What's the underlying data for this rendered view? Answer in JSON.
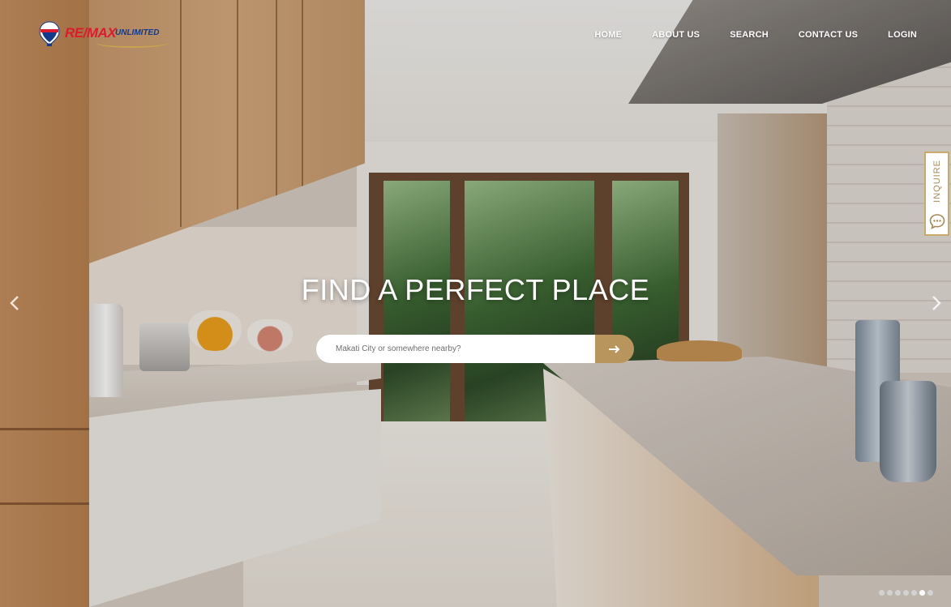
{
  "brand": {
    "balloon_text": "RE/MAX",
    "name_primary": "RE/MAX",
    "name_secondary": "UNLIMITED",
    "colors": {
      "red": "#dc1c2e",
      "blue": "#13398c",
      "gold": "#c9a24e"
    }
  },
  "nav": {
    "items": [
      {
        "label": "HOME"
      },
      {
        "label": "ABOUT US"
      },
      {
        "label": "SEARCH"
      },
      {
        "label": "CONTACT US"
      },
      {
        "label": "LOGIN"
      }
    ]
  },
  "hero": {
    "headline": "FIND A PERFECT PLACE",
    "search_placeholder": "Makati City or somewhere nearby?",
    "search_button_icon": "arrow-right-icon",
    "accent_color": "#b8955c"
  },
  "carousel": {
    "prev_icon": "chevron-left-icon",
    "next_icon": "chevron-right-icon",
    "slide_count": 7,
    "active_index": 5
  },
  "inquire_tab": {
    "label": "INQUIRE",
    "icon": "chat-bubble-icon"
  }
}
